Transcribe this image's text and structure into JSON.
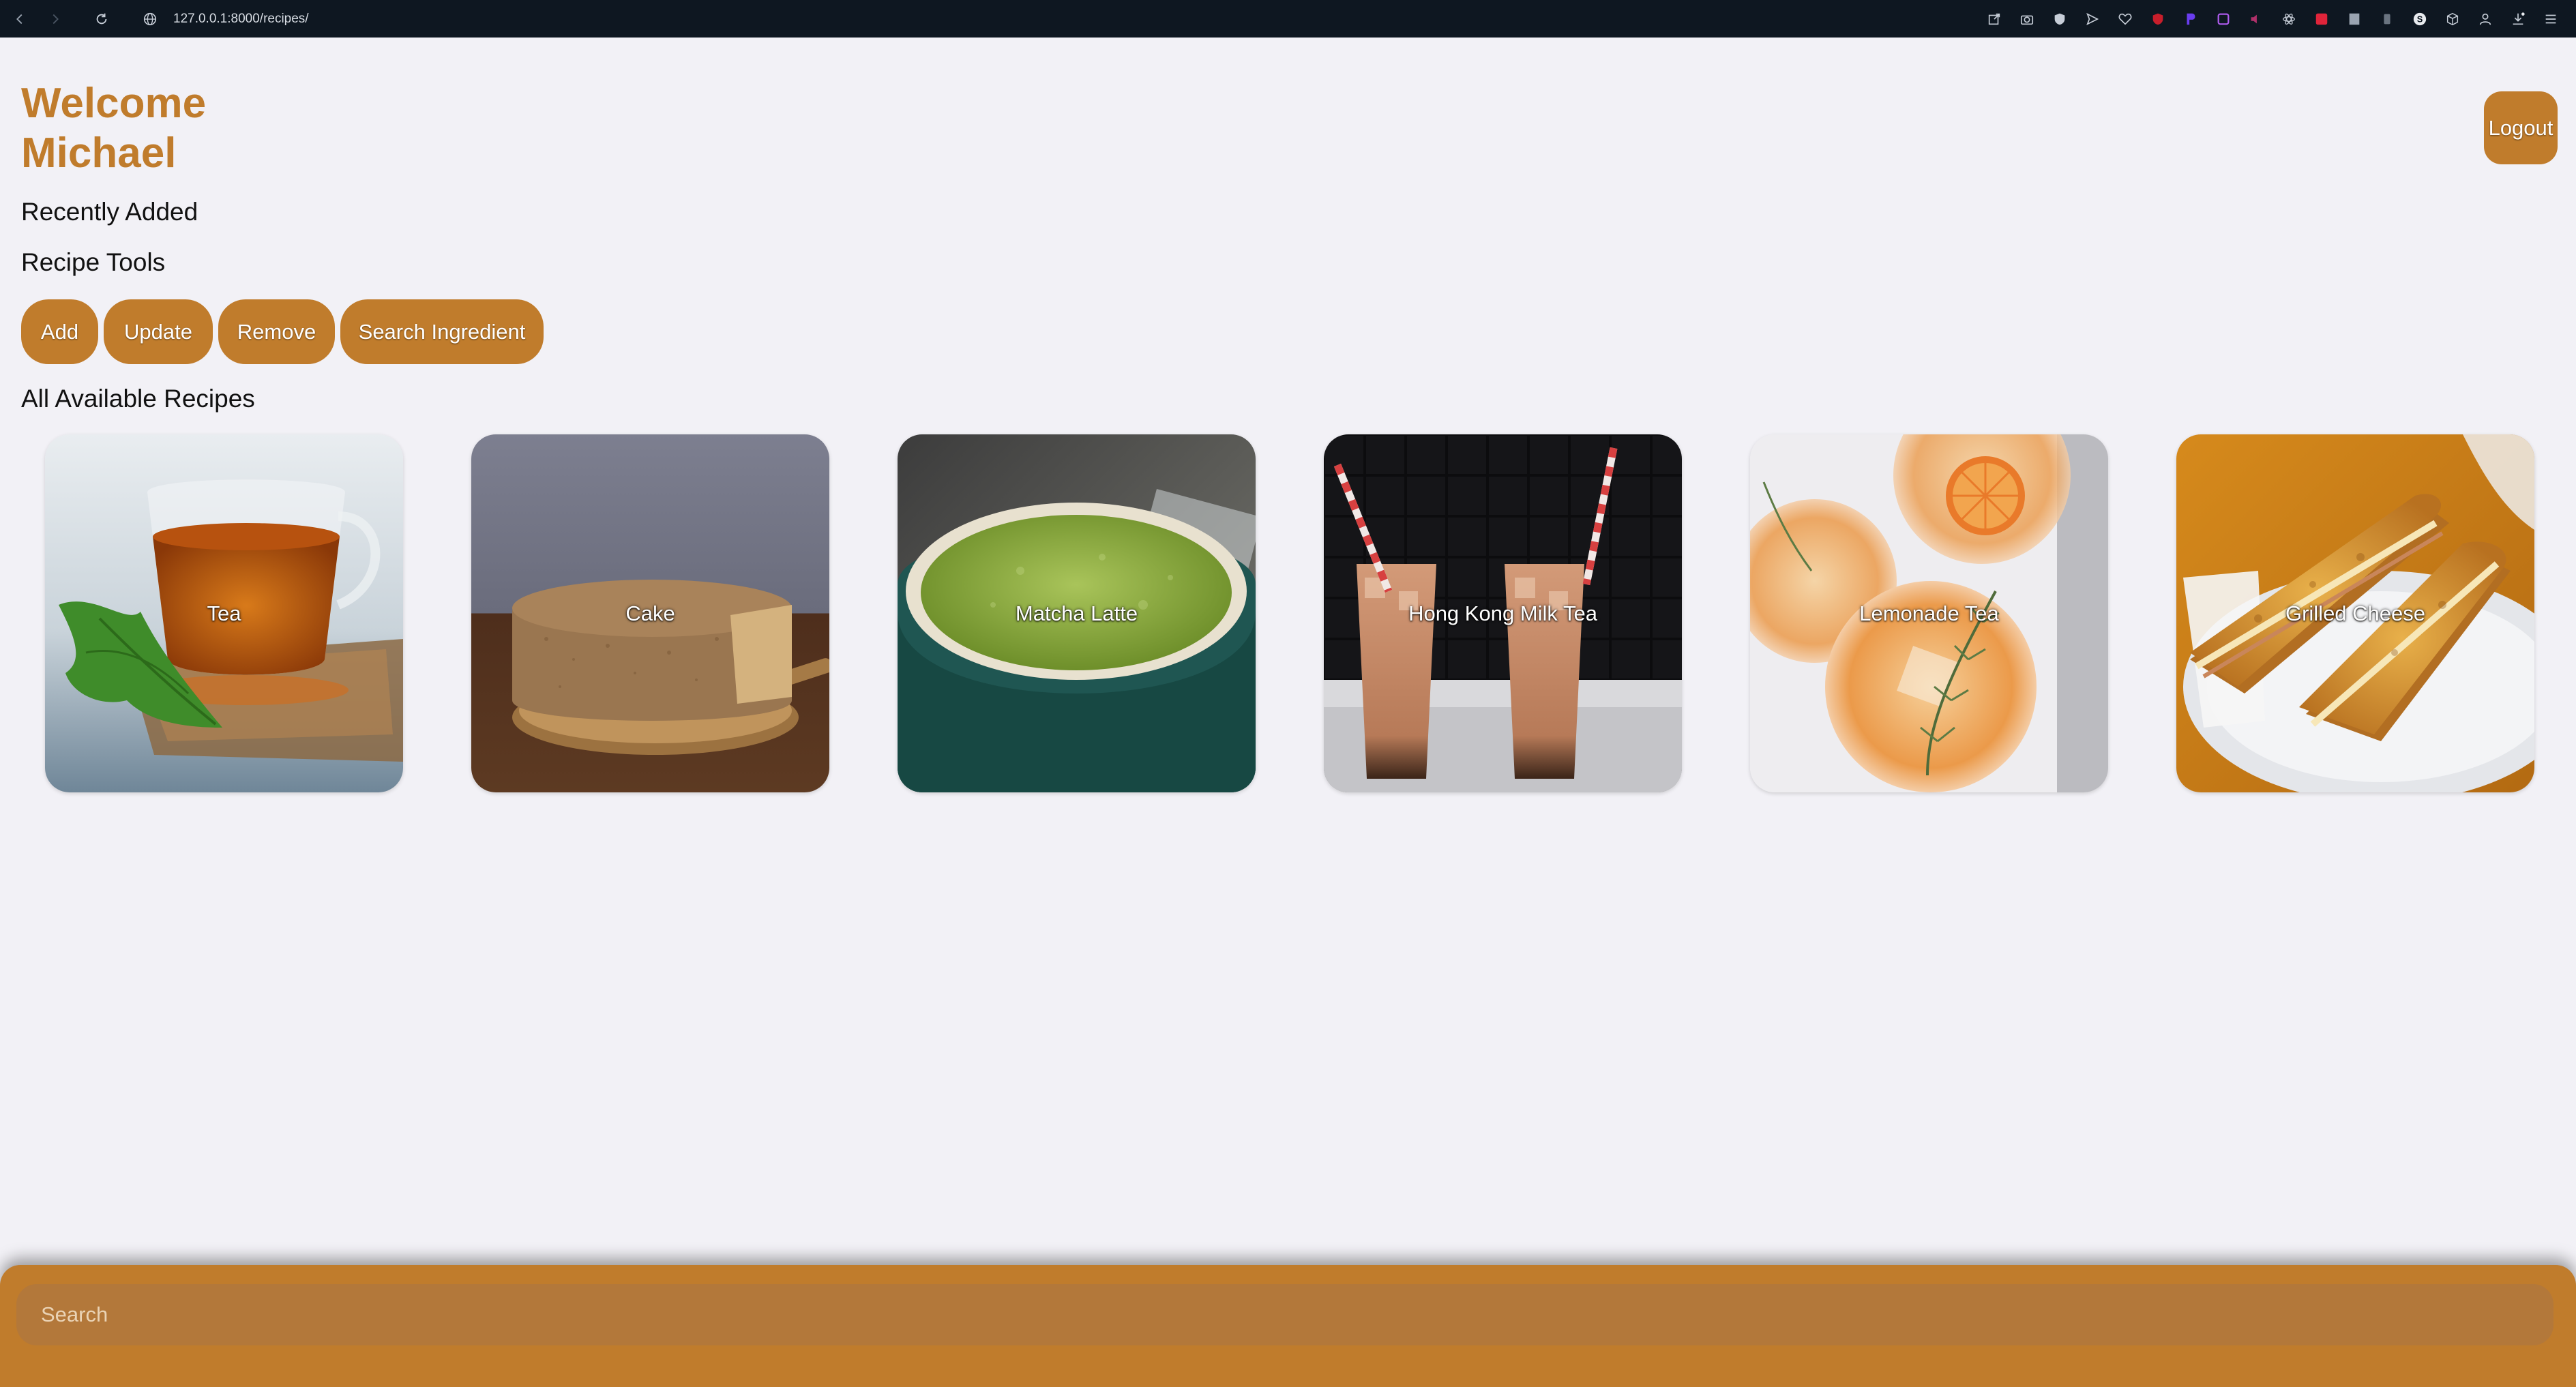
{
  "browser": {
    "url": "127.0.0.1:8000/recipes/",
    "extensions": [
      "share-icon",
      "camera-icon",
      "shield-icon",
      "send-icon",
      "heart-icon",
      "ublock-icon",
      "p-icon",
      "puzzle-icon",
      "audio-icon",
      "react-icon",
      "red-square-icon",
      "doc-icon",
      "tab-icon",
      "s-icon",
      "box-icon",
      "person-icon",
      "download-icon",
      "menu-icon"
    ]
  },
  "header": {
    "welcome_line1": "Welcome",
    "welcome_line2": "Michael",
    "logout_label": "Logout"
  },
  "sections": {
    "recently_added": "Recently Added",
    "recipe_tools": "Recipe Tools",
    "all_recipes": "All Available Recipes"
  },
  "tools": {
    "add": "Add",
    "update": "Update",
    "remove": "Remove",
    "search_ingredient": "Search Ingredient"
  },
  "recipes": [
    {
      "name": "Tea",
      "image": "tea-cup-image"
    },
    {
      "name": "Cake",
      "image": "sponge-cake-image"
    },
    {
      "name": "Matcha Latte",
      "image": "matcha-latte-image"
    },
    {
      "name": "Hong Kong Milk Tea",
      "image": "milk-tea-glasses-image"
    },
    {
      "name": "Lemonade Tea",
      "image": "lemonade-tea-image"
    },
    {
      "name": "Grilled Cheese",
      "image": "grilled-cheese-image"
    }
  ],
  "search": {
    "placeholder": "Search"
  },
  "colors": {
    "accent": "#c07c2c",
    "page_background": "#f2f1f6",
    "chrome": "#0e1721"
  }
}
